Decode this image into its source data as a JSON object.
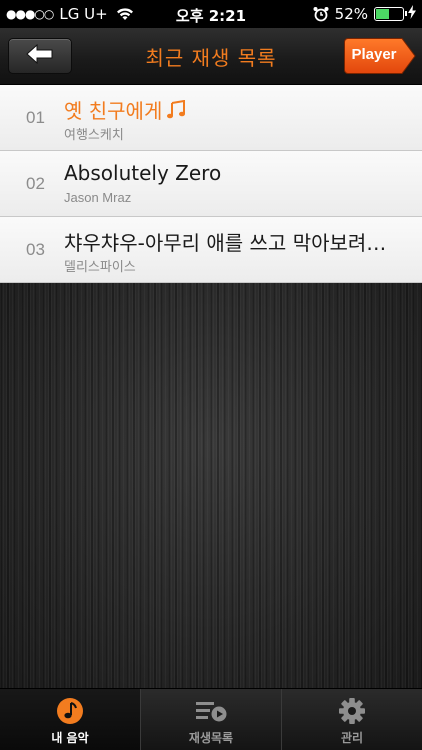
{
  "status_bar": {
    "signal": "●●●○○",
    "carrier": "LG U+",
    "time": "오후 2:21",
    "battery_percent": "52%",
    "battery_level": 0.52,
    "icons": [
      "wifi-icon",
      "alarm-icon",
      "battery-icon",
      "charging-bolt-icon"
    ]
  },
  "nav": {
    "title": "최근 재생 목록",
    "back_icon": "left-arrow-icon",
    "player_label": "Player"
  },
  "songs": [
    {
      "num": "01",
      "title": "옛 친구에게",
      "artist": "여행스케치",
      "playing": true
    },
    {
      "num": "02",
      "title": "Absolutely Zero",
      "artist": "Jason Mraz",
      "playing": false
    },
    {
      "num": "03",
      "title": "챠우챠우-아무리 애를 쓰고 막아보려고 해도",
      "artist": "델리스파이스",
      "playing": false
    }
  ],
  "tabs": [
    {
      "label": "내 음악",
      "icon": "music-note-icon",
      "selected": true
    },
    {
      "label": "재생목록",
      "icon": "playlist-icon",
      "selected": false
    },
    {
      "label": "관리",
      "icon": "gear-icon",
      "selected": false
    }
  ],
  "colors": {
    "accent": "#f27c1f",
    "list_bg": "#f5f5f5",
    "bar_bg": "#1b1b1b"
  }
}
